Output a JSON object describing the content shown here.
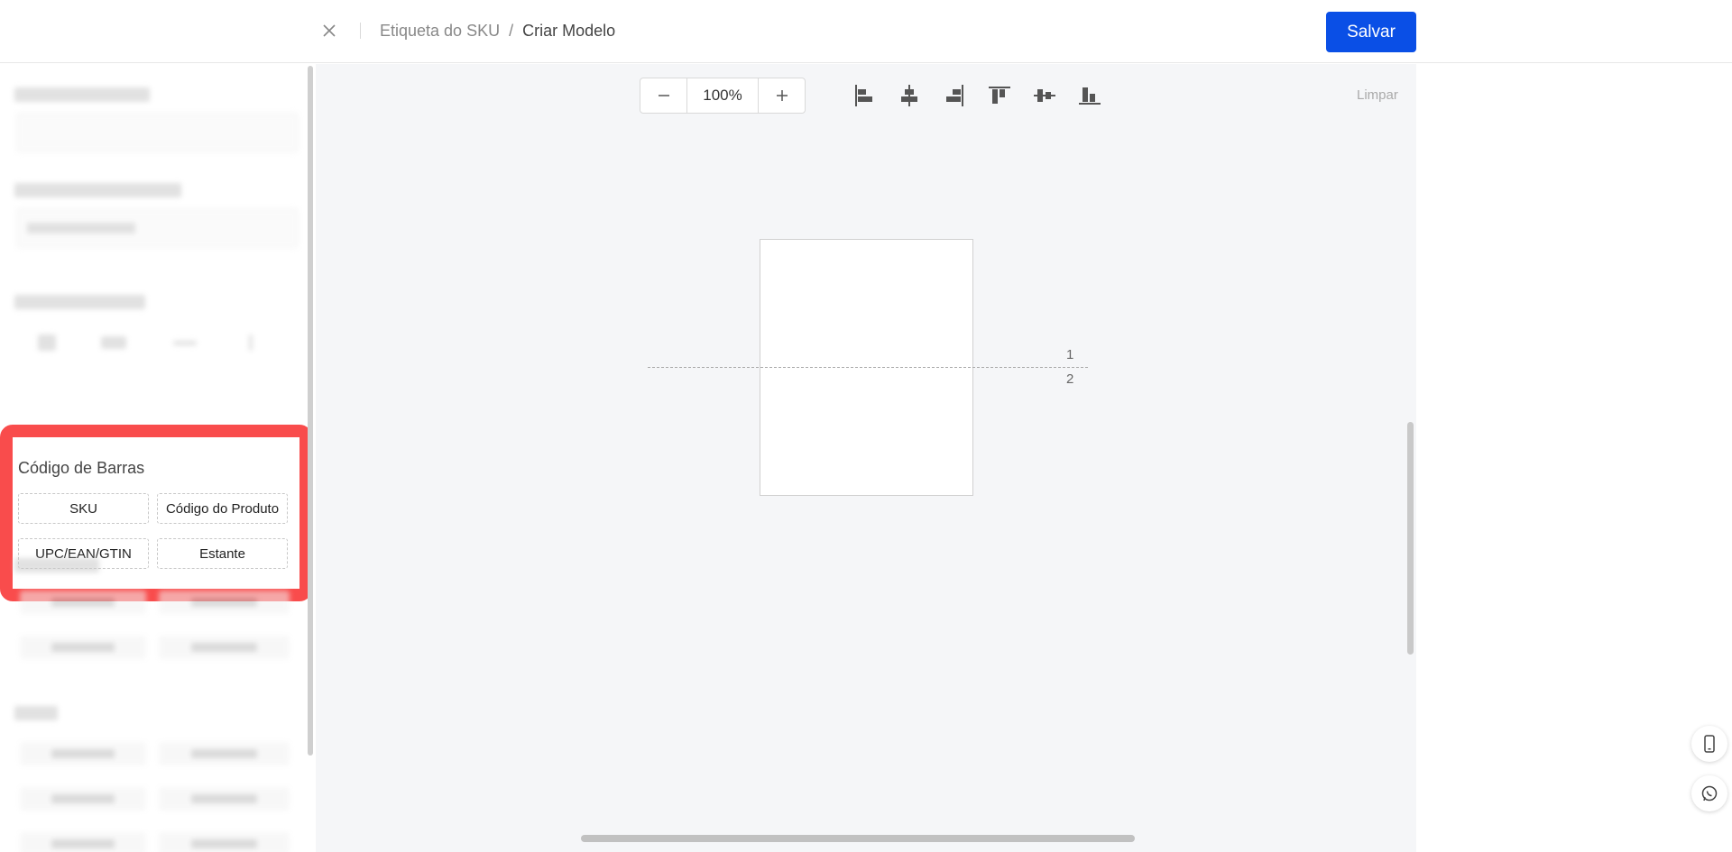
{
  "header": {
    "breadcrumb": [
      {
        "label": "Etiqueta do SKU"
      },
      {
        "separator": "/"
      },
      {
        "label": "Criar Modelo"
      }
    ],
    "save_label": "Salvar",
    "icons": {
      "close": "close-icon"
    }
  },
  "left_panel": {
    "barcode_section": {
      "title": "Código de Barras",
      "buttons": [
        "SKU",
        "Código do Produto",
        "UPC/EAN/GTIN",
        "Estante"
      ]
    }
  },
  "toolbar": {
    "zoom_value": "100%",
    "zoom_out_icon": "minus-icon",
    "zoom_in_icon": "plus-icon",
    "align_tools": [
      "align-left-icon",
      "align-center-horizontal-icon",
      "align-right-icon",
      "align-top-icon",
      "align-middle-vertical-icon",
      "align-bottom-icon"
    ],
    "clear_label": "Limpar"
  },
  "canvas": {
    "page_numbers": [
      "1",
      "2"
    ]
  },
  "floating": {
    "phone_icon": "phone-icon",
    "whatsapp_icon": "whatsapp-icon"
  },
  "colors": {
    "accent": "#0a4fe6",
    "highlight": "#f94c4c"
  }
}
